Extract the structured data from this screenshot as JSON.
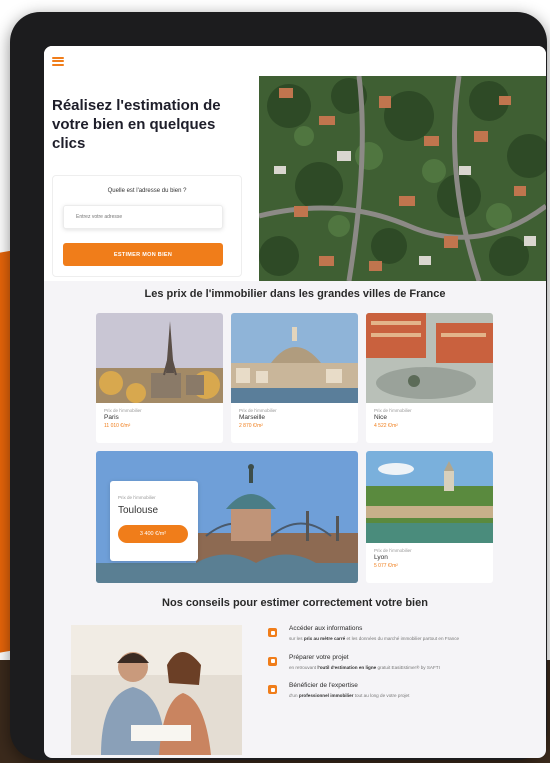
{
  "hero": {
    "title": "Réalisez l'estimation de votre bien en quelques clics",
    "question": "Quelle est l'adresse du bien ?",
    "input_placeholder": "Entrez votre adresse",
    "button_label": "ESTIMER MON BIEN"
  },
  "cities": {
    "title": "Les prix de l'immobilier dans les grandes villes de France",
    "price_prefix": "Prix de l'immobilier",
    "items": [
      {
        "name": "Paris",
        "price": "11 010 €/m²"
      },
      {
        "name": "Marseille",
        "price": "2 870 €/m²"
      },
      {
        "name": "Nice",
        "price": "4 522 €/m²"
      },
      {
        "name": "Toulouse",
        "price": "3 400 €/m²"
      },
      {
        "name": "Lyon",
        "price": "5 077 €/m²"
      }
    ]
  },
  "tips": {
    "title": "Nos conseils pour estimer correctement votre bien",
    "items": [
      {
        "title": "Accéder aux informations",
        "text_before": "sur les ",
        "text_bold": "prix au mètre carré",
        "text_after": " et les données du marché immobilier partout en France",
        "icon": "bookmark-icon"
      },
      {
        "title": "Préparer votre projet",
        "text_before": "en retrouvant ",
        "text_bold": "l'outil d'estimation en ligne",
        "text_after": " gratuit EasiEstimer® by SAFTI",
        "icon": "mail-icon"
      },
      {
        "title": "Bénéficier de l'expertise",
        "text_before": "d'un ",
        "text_bold": "professionnel immobilier",
        "text_after": " tout au long de votre projet",
        "icon": "user-badge-icon"
      }
    ]
  },
  "colors": {
    "accent": "#f07d1a",
    "frame": "#1c1c1e",
    "page_bg": "#f5f4f7"
  }
}
